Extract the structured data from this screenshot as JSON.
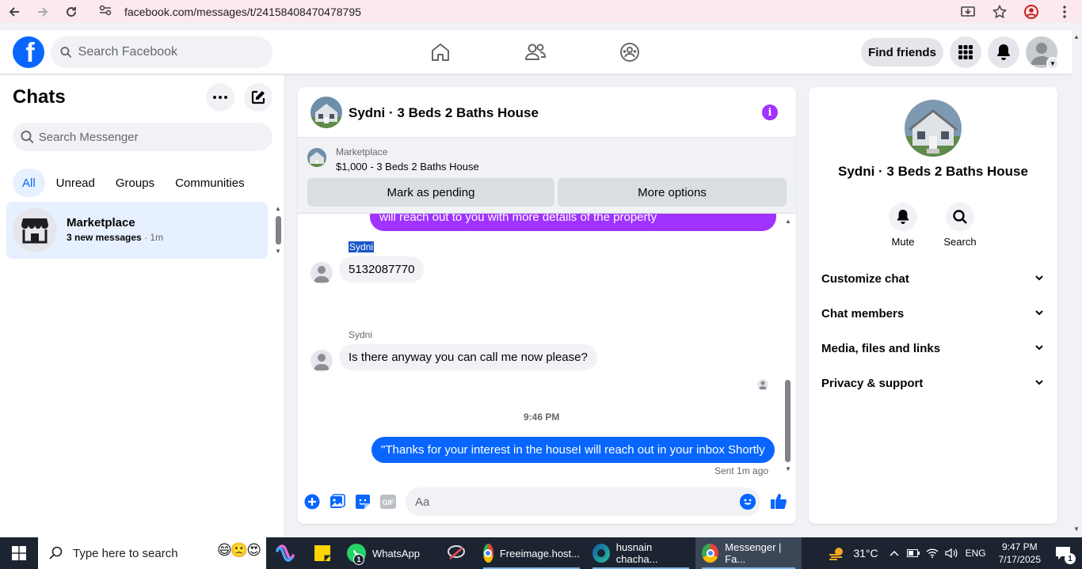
{
  "browser": {
    "url": "facebook.com/messages/t/24158408470478795"
  },
  "header": {
    "logo_letter": "f",
    "search_placeholder": "Search Facebook",
    "find_friends": "Find friends"
  },
  "sidebar": {
    "title": "Chats",
    "search_placeholder": "Search Messenger",
    "tabs": [
      {
        "label": "All",
        "active": true
      },
      {
        "label": "Unread",
        "active": false
      },
      {
        "label": "Groups",
        "active": false
      },
      {
        "label": "Communities",
        "active": false
      }
    ],
    "chats": [
      {
        "name": "Marketplace",
        "preview": "3 new messages",
        "separator": " · ",
        "time": "1m"
      }
    ]
  },
  "chat": {
    "title": "Sydni · 3 Beds 2 Baths House",
    "info_glyph": "i",
    "marketplace": {
      "label": "Marketplace",
      "listing": "$1,000 - 3 Beds 2 Baths House",
      "mark_pending": "Mark as pending",
      "more_options": "More options"
    },
    "messages": {
      "prev_out": "will reach out to you with more details of the property",
      "sender1": "Sydni",
      "msg1": "5132087770",
      "sender2": "Sydni",
      "msg2": "Is there anyway you can call me now please?",
      "timestamp": "9:46 PM",
      "msg3": "\"Thanks for your interest in the houseI will reach out in your inbox Shortly",
      "sent_status": "Sent 1m ago"
    },
    "composer_placeholder": "Aa",
    "gif_label": "GIF"
  },
  "details": {
    "name": "Sydni · 3 Beds 2 Baths House",
    "actions": [
      {
        "label": "Mute"
      },
      {
        "label": "Search"
      }
    ],
    "sections": [
      {
        "label": "Customize chat"
      },
      {
        "label": "Chat members"
      },
      {
        "label": "Media, files and links"
      },
      {
        "label": "Privacy & support"
      }
    ]
  },
  "taskbar": {
    "search_placeholder": "Type here to search",
    "apps": [
      {
        "label": "WhatsApp",
        "badge": "1"
      },
      {
        "label": "Freeimage.host..."
      },
      {
        "label": "husnain chacha..."
      },
      {
        "label": "Messenger | Fa..."
      }
    ],
    "weather": "31°C",
    "lang": "ENG",
    "time": "9:47 PM",
    "date": "7/17/2025",
    "notif_count": "1"
  },
  "colors": {
    "brand_blue": "#0866ff",
    "purple": "#a033ff",
    "selected_bg": "#e7f0fe"
  }
}
